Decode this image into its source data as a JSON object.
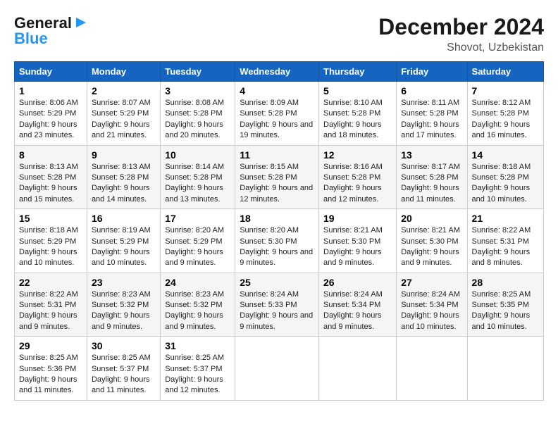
{
  "logo": {
    "line1": "General",
    "line2": "Blue"
  },
  "title": "December 2024",
  "subtitle": "Shovot, Uzbekistan",
  "weekdays": [
    "Sunday",
    "Monday",
    "Tuesday",
    "Wednesday",
    "Thursday",
    "Friday",
    "Saturday"
  ],
  "weeks": [
    [
      {
        "day": "1",
        "sunrise": "8:06 AM",
        "sunset": "5:29 PM",
        "daylight": "9 hours and 23 minutes."
      },
      {
        "day": "2",
        "sunrise": "8:07 AM",
        "sunset": "5:29 PM",
        "daylight": "9 hours and 21 minutes."
      },
      {
        "day": "3",
        "sunrise": "8:08 AM",
        "sunset": "5:28 PM",
        "daylight": "9 hours and 20 minutes."
      },
      {
        "day": "4",
        "sunrise": "8:09 AM",
        "sunset": "5:28 PM",
        "daylight": "9 hours and 19 minutes."
      },
      {
        "day": "5",
        "sunrise": "8:10 AM",
        "sunset": "5:28 PM",
        "daylight": "9 hours and 18 minutes."
      },
      {
        "day": "6",
        "sunrise": "8:11 AM",
        "sunset": "5:28 PM",
        "daylight": "9 hours and 17 minutes."
      },
      {
        "day": "7",
        "sunrise": "8:12 AM",
        "sunset": "5:28 PM",
        "daylight": "9 hours and 16 minutes."
      }
    ],
    [
      {
        "day": "8",
        "sunrise": "8:13 AM",
        "sunset": "5:28 PM",
        "daylight": "9 hours and 15 minutes."
      },
      {
        "day": "9",
        "sunrise": "8:13 AM",
        "sunset": "5:28 PM",
        "daylight": "9 hours and 14 minutes."
      },
      {
        "day": "10",
        "sunrise": "8:14 AM",
        "sunset": "5:28 PM",
        "daylight": "9 hours and 13 minutes."
      },
      {
        "day": "11",
        "sunrise": "8:15 AM",
        "sunset": "5:28 PM",
        "daylight": "9 hours and 12 minutes."
      },
      {
        "day": "12",
        "sunrise": "8:16 AM",
        "sunset": "5:28 PM",
        "daylight": "9 hours and 12 minutes."
      },
      {
        "day": "13",
        "sunrise": "8:17 AM",
        "sunset": "5:28 PM",
        "daylight": "9 hours and 11 minutes."
      },
      {
        "day": "14",
        "sunrise": "8:18 AM",
        "sunset": "5:28 PM",
        "daylight": "9 hours and 10 minutes."
      }
    ],
    [
      {
        "day": "15",
        "sunrise": "8:18 AM",
        "sunset": "5:29 PM",
        "daylight": "9 hours and 10 minutes."
      },
      {
        "day": "16",
        "sunrise": "8:19 AM",
        "sunset": "5:29 PM",
        "daylight": "9 hours and 10 minutes."
      },
      {
        "day": "17",
        "sunrise": "8:20 AM",
        "sunset": "5:29 PM",
        "daylight": "9 hours and 9 minutes."
      },
      {
        "day": "18",
        "sunrise": "8:20 AM",
        "sunset": "5:30 PM",
        "daylight": "9 hours and 9 minutes."
      },
      {
        "day": "19",
        "sunrise": "8:21 AM",
        "sunset": "5:30 PM",
        "daylight": "9 hours and 9 minutes."
      },
      {
        "day": "20",
        "sunrise": "8:21 AM",
        "sunset": "5:30 PM",
        "daylight": "9 hours and 9 minutes."
      },
      {
        "day": "21",
        "sunrise": "8:22 AM",
        "sunset": "5:31 PM",
        "daylight": "9 hours and 8 minutes."
      }
    ],
    [
      {
        "day": "22",
        "sunrise": "8:22 AM",
        "sunset": "5:31 PM",
        "daylight": "9 hours and 9 minutes."
      },
      {
        "day": "23",
        "sunrise": "8:23 AM",
        "sunset": "5:32 PM",
        "daylight": "9 hours and 9 minutes."
      },
      {
        "day": "24",
        "sunrise": "8:23 AM",
        "sunset": "5:32 PM",
        "daylight": "9 hours and 9 minutes."
      },
      {
        "day": "25",
        "sunrise": "8:24 AM",
        "sunset": "5:33 PM",
        "daylight": "9 hours and 9 minutes."
      },
      {
        "day": "26",
        "sunrise": "8:24 AM",
        "sunset": "5:34 PM",
        "daylight": "9 hours and 9 minutes."
      },
      {
        "day": "27",
        "sunrise": "8:24 AM",
        "sunset": "5:34 PM",
        "daylight": "9 hours and 10 minutes."
      },
      {
        "day": "28",
        "sunrise": "8:25 AM",
        "sunset": "5:35 PM",
        "daylight": "9 hours and 10 minutes."
      }
    ],
    [
      {
        "day": "29",
        "sunrise": "8:25 AM",
        "sunset": "5:36 PM",
        "daylight": "9 hours and 11 minutes."
      },
      {
        "day": "30",
        "sunrise": "8:25 AM",
        "sunset": "5:37 PM",
        "daylight": "9 hours and 11 minutes."
      },
      {
        "day": "31",
        "sunrise": "8:25 AM",
        "sunset": "5:37 PM",
        "daylight": "9 hours and 12 minutes."
      },
      null,
      null,
      null,
      null
    ]
  ]
}
